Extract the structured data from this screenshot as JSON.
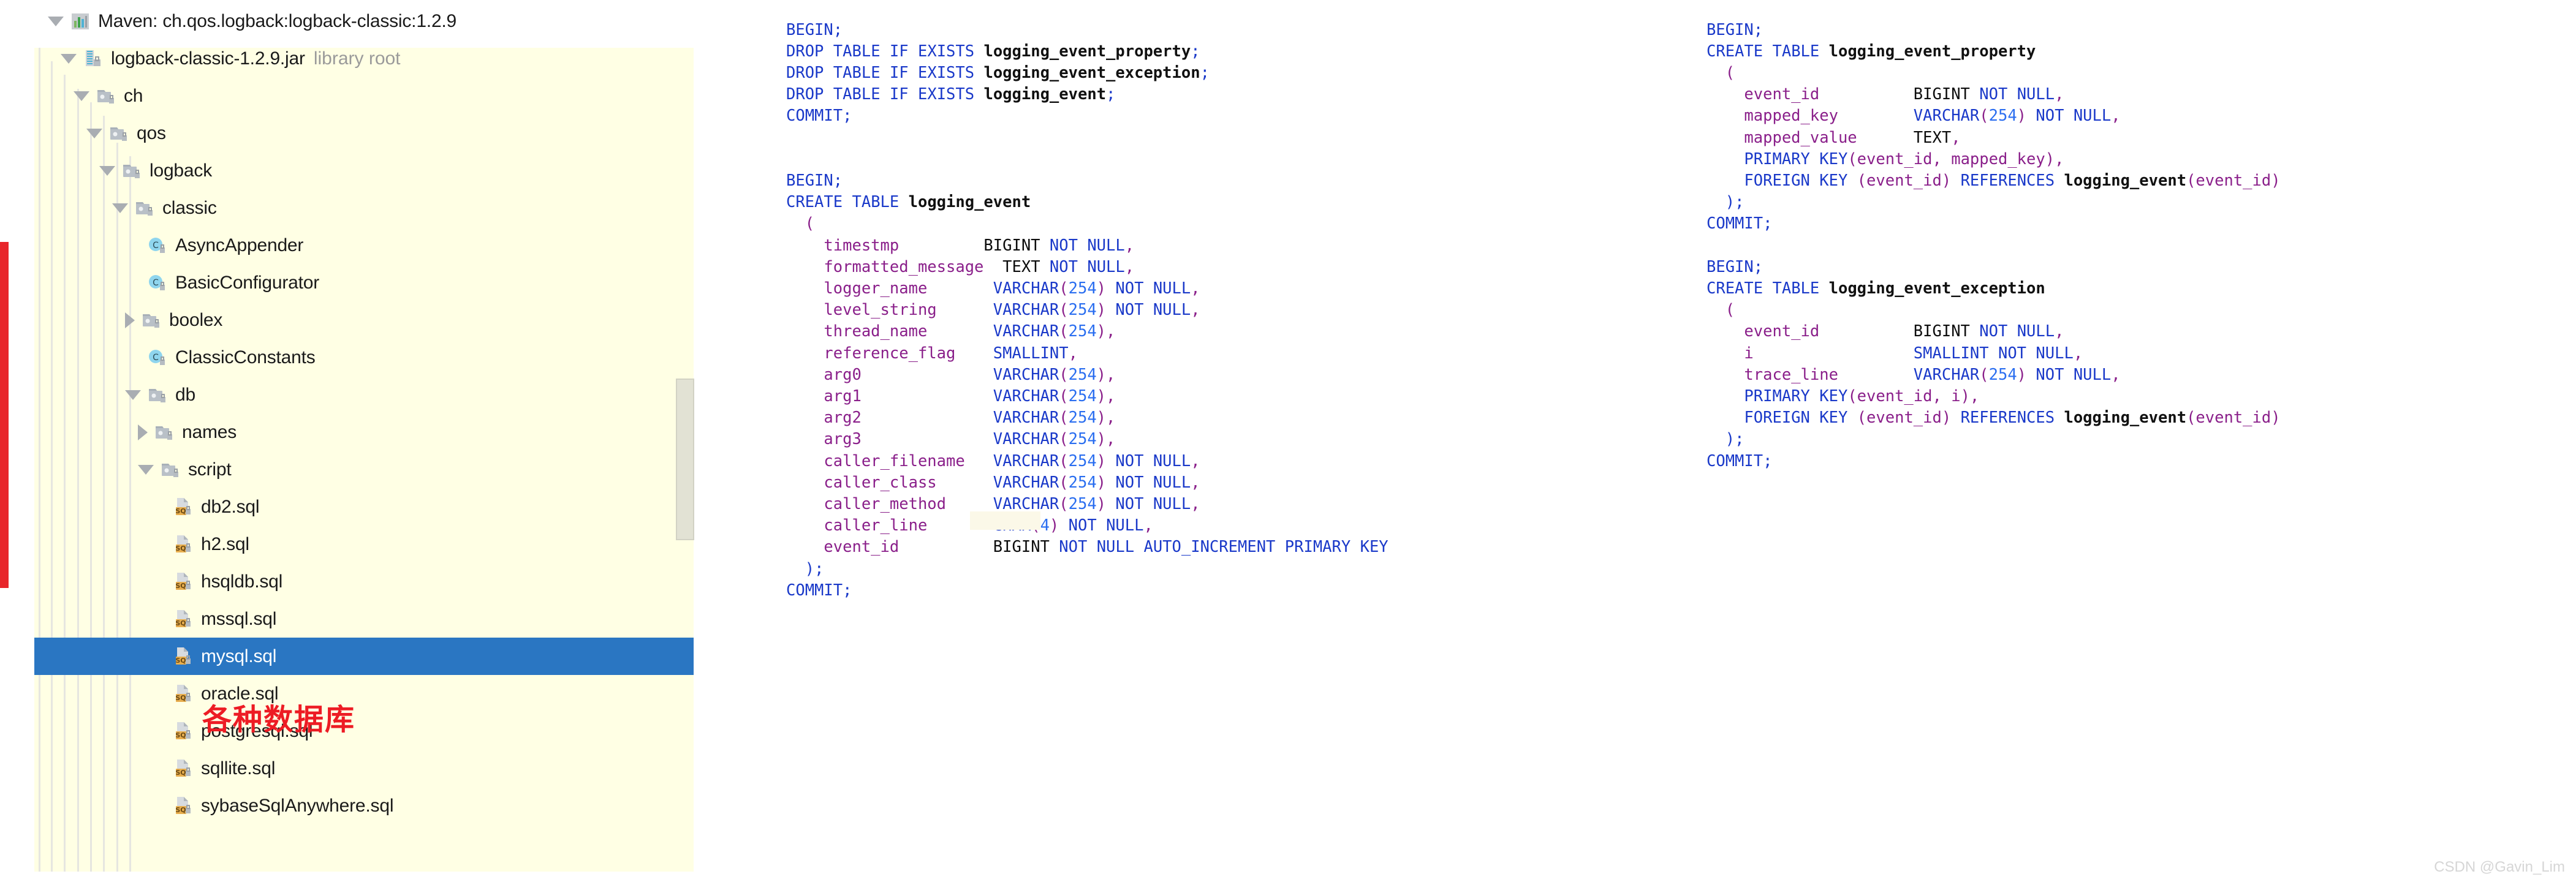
{
  "tree": {
    "scrollbar": {
      "name": "vertical-scrollbar"
    },
    "rows": [
      {
        "label": "Maven: ch.qos.logback:logback-classic:1.2.9",
        "sub": "",
        "icon": "maven-icon",
        "twisty": "down",
        "depth": 0,
        "selected": false
      },
      {
        "label": "logback-classic-1.2.9.jar",
        "sub": "library root",
        "icon": "jar-icon",
        "twisty": "down",
        "depth": 1,
        "selected": false
      },
      {
        "label": "ch",
        "sub": "",
        "icon": "package-icon",
        "twisty": "down",
        "depth": 2,
        "selected": false
      },
      {
        "label": "qos",
        "sub": "",
        "icon": "package-icon",
        "twisty": "down",
        "depth": 3,
        "selected": false
      },
      {
        "label": "logback",
        "sub": "",
        "icon": "package-icon",
        "twisty": "down",
        "depth": 4,
        "selected": false
      },
      {
        "label": "classic",
        "sub": "",
        "icon": "package-icon",
        "twisty": "down",
        "depth": 5,
        "selected": false
      },
      {
        "label": "AsyncAppender",
        "sub": "",
        "icon": "class-icon",
        "twisty": "none",
        "depth": 6,
        "selected": false
      },
      {
        "label": "BasicConfigurator",
        "sub": "",
        "icon": "class-icon",
        "twisty": "none",
        "depth": 6,
        "selected": false
      },
      {
        "label": "boolex",
        "sub": "",
        "icon": "package-icon",
        "twisty": "right",
        "depth": 6,
        "selected": false
      },
      {
        "label": "ClassicConstants",
        "sub": "",
        "icon": "class-icon",
        "twisty": "none",
        "depth": 6,
        "selected": false
      },
      {
        "label": "db",
        "sub": "",
        "icon": "package-icon",
        "twisty": "down",
        "depth": 6,
        "selected": false
      },
      {
        "label": "names",
        "sub": "",
        "icon": "package-icon",
        "twisty": "right",
        "depth": 7,
        "selected": false
      },
      {
        "label": "script",
        "sub": "",
        "icon": "package-icon",
        "twisty": "down",
        "depth": 7,
        "selected": false
      },
      {
        "label": "db2.sql",
        "sub": "",
        "icon": "sql-file-icon",
        "twisty": "none",
        "depth": 8,
        "selected": false
      },
      {
        "label": "h2.sql",
        "sub": "",
        "icon": "sql-file-icon",
        "twisty": "none",
        "depth": 8,
        "selected": false
      },
      {
        "label": "hsqldb.sql",
        "sub": "",
        "icon": "sql-file-icon",
        "twisty": "none",
        "depth": 8,
        "selected": false
      },
      {
        "label": "mssql.sql",
        "sub": "",
        "icon": "sql-file-icon",
        "twisty": "none",
        "depth": 8,
        "selected": false
      },
      {
        "label": "mysql.sql",
        "sub": "",
        "icon": "sql-file-icon",
        "twisty": "none",
        "depth": 8,
        "selected": true
      },
      {
        "label": "oracle.sql",
        "sub": "",
        "icon": "sql-file-icon",
        "twisty": "none",
        "depth": 8,
        "selected": false
      },
      {
        "label": "postgresql.sql",
        "sub": "",
        "icon": "sql-file-icon",
        "twisty": "none",
        "depth": 8,
        "selected": false
      },
      {
        "label": "sqllite.sql",
        "sub": "",
        "icon": "sql-file-icon",
        "twisty": "none",
        "depth": 8,
        "selected": false
      },
      {
        "label": "sybaseSqlAnywhere.sql",
        "sub": "",
        "icon": "sql-file-icon",
        "twisty": "none",
        "depth": 8,
        "selected": false
      }
    ]
  },
  "annotation": {
    "red_note": "各种数据库",
    "red_bracket_color": "#e8252a"
  },
  "editor": {
    "selected_file": "mysql.sql",
    "columns": [
      {
        "name": "left-sql-column",
        "lines": [
          "BEGIN;",
          "DROP TABLE IF EXISTS logging_event_property;",
          "DROP TABLE IF EXISTS logging_event_exception;",
          "DROP TABLE IF EXISTS logging_event;",
          "COMMIT;",
          "",
          "",
          "BEGIN;",
          "CREATE TABLE logging_event",
          "  (",
          "    timestmp         BIGINT NOT NULL,",
          "    formatted_message  TEXT NOT NULL,",
          "    logger_name       VARCHAR(254) NOT NULL,",
          "    level_string      VARCHAR(254) NOT NULL,",
          "    thread_name       VARCHAR(254),",
          "    reference_flag    SMALLINT,",
          "    arg0              VARCHAR(254),",
          "    arg1              VARCHAR(254),",
          "    arg2              VARCHAR(254),",
          "    arg3              VARCHAR(254),",
          "    caller_filename   VARCHAR(254) NOT NULL,",
          "    caller_class      VARCHAR(254) NOT NULL,",
          "    caller_method     VARCHAR(254) NOT NULL,",
          "    caller_line       CHAR(4) NOT NULL,",
          "    event_id          BIGINT NOT NULL AUTO_INCREMENT PRIMARY KEY",
          "  );",
          "COMMIT;"
        ]
      },
      {
        "name": "right-sql-column",
        "lines": [
          "BEGIN;",
          "CREATE TABLE logging_event_property",
          "  (",
          "    event_id          BIGINT NOT NULL,",
          "    mapped_key        VARCHAR(254) NOT NULL,",
          "    mapped_value      TEXT,",
          "    PRIMARY KEY(event_id, mapped_key),",
          "    FOREIGN KEY (event_id) REFERENCES logging_event(event_id)",
          "  );",
          "COMMIT;",
          "",
          "BEGIN;",
          "CREATE TABLE logging_event_exception",
          "  (",
          "    event_id          BIGINT NOT NULL,",
          "    i                 SMALLINT NOT NULL,",
          "    trace_line        VARCHAR(254) NOT NULL,",
          "    PRIMARY KEY(event_id, i),",
          "    FOREIGN KEY (event_id) REFERENCES logging_event(event_id)",
          "  );",
          "COMMIT;"
        ]
      }
    ]
  },
  "watermark": {
    "text": "CSDN @Gavin_Lim"
  }
}
